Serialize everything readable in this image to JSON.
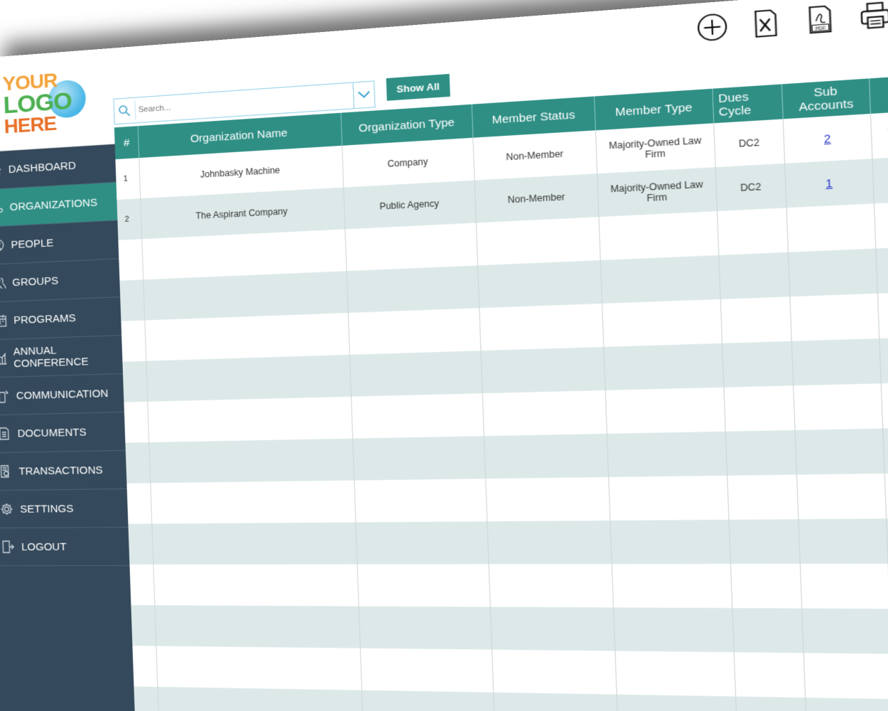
{
  "logo": {
    "line1": "YOUR",
    "line2": "LOGO",
    "line3": "HERE"
  },
  "sidebar": {
    "items": [
      {
        "label": "DASHBOARD",
        "icon": "home-icon",
        "active": false
      },
      {
        "label": "ORGANIZATIONS",
        "icon": "organization-tree-icon",
        "active": true
      },
      {
        "label": "PEOPLE",
        "icon": "person-icon",
        "active": false
      },
      {
        "label": "GROUPS",
        "icon": "group-icon",
        "active": false
      },
      {
        "label": "PROGRAMS",
        "icon": "calendar-icon",
        "active": false
      },
      {
        "label": "ANNUAL CONFERENCE",
        "icon": "chart-icon",
        "active": false
      },
      {
        "label": "COMMUNICATION",
        "icon": "phone-icon",
        "active": false
      },
      {
        "label": "DOCUMENTS",
        "icon": "document-icon",
        "active": false
      },
      {
        "label": "TRANSACTIONS",
        "icon": "receipt-icon",
        "active": false
      },
      {
        "label": "SETTINGS",
        "icon": "gear-icon",
        "active": false
      },
      {
        "label": "LOGOUT",
        "icon": "logout-icon",
        "active": false
      }
    ]
  },
  "toolbar": {
    "add_icon": "add-circle-icon",
    "excel_icon": "excel-export-icon",
    "pdf_icon": "pdf-export-icon",
    "pdf_label": "PDF",
    "print_icon": "print-icon"
  },
  "search": {
    "placeholder": "Search...",
    "value": ""
  },
  "show_all_label": "Show All",
  "table": {
    "headers": {
      "num": "#",
      "name": "Organization Name",
      "type": "Organization Type",
      "status": "Member Status",
      "mtype": "Member Type",
      "dues": "Dues Cycle",
      "sub": "Sub Accounts"
    },
    "rows": [
      {
        "num": "1",
        "name": "Johnbasky Machine",
        "type": "Company",
        "status": "Non-Member",
        "mtype": "Majority-Owned Law Firm",
        "dues": "DC2",
        "sub": "2"
      },
      {
        "num": "2",
        "name": "The Aspirant Company",
        "type": "Public Agency",
        "status": "Non-Member",
        "mtype": "Majority-Owned Law Firm",
        "dues": "DC2",
        "sub": "1"
      }
    ]
  },
  "colors": {
    "accent": "#2f8f85",
    "sidebar": "#34495b",
    "row_alt": "#dde9e9"
  }
}
